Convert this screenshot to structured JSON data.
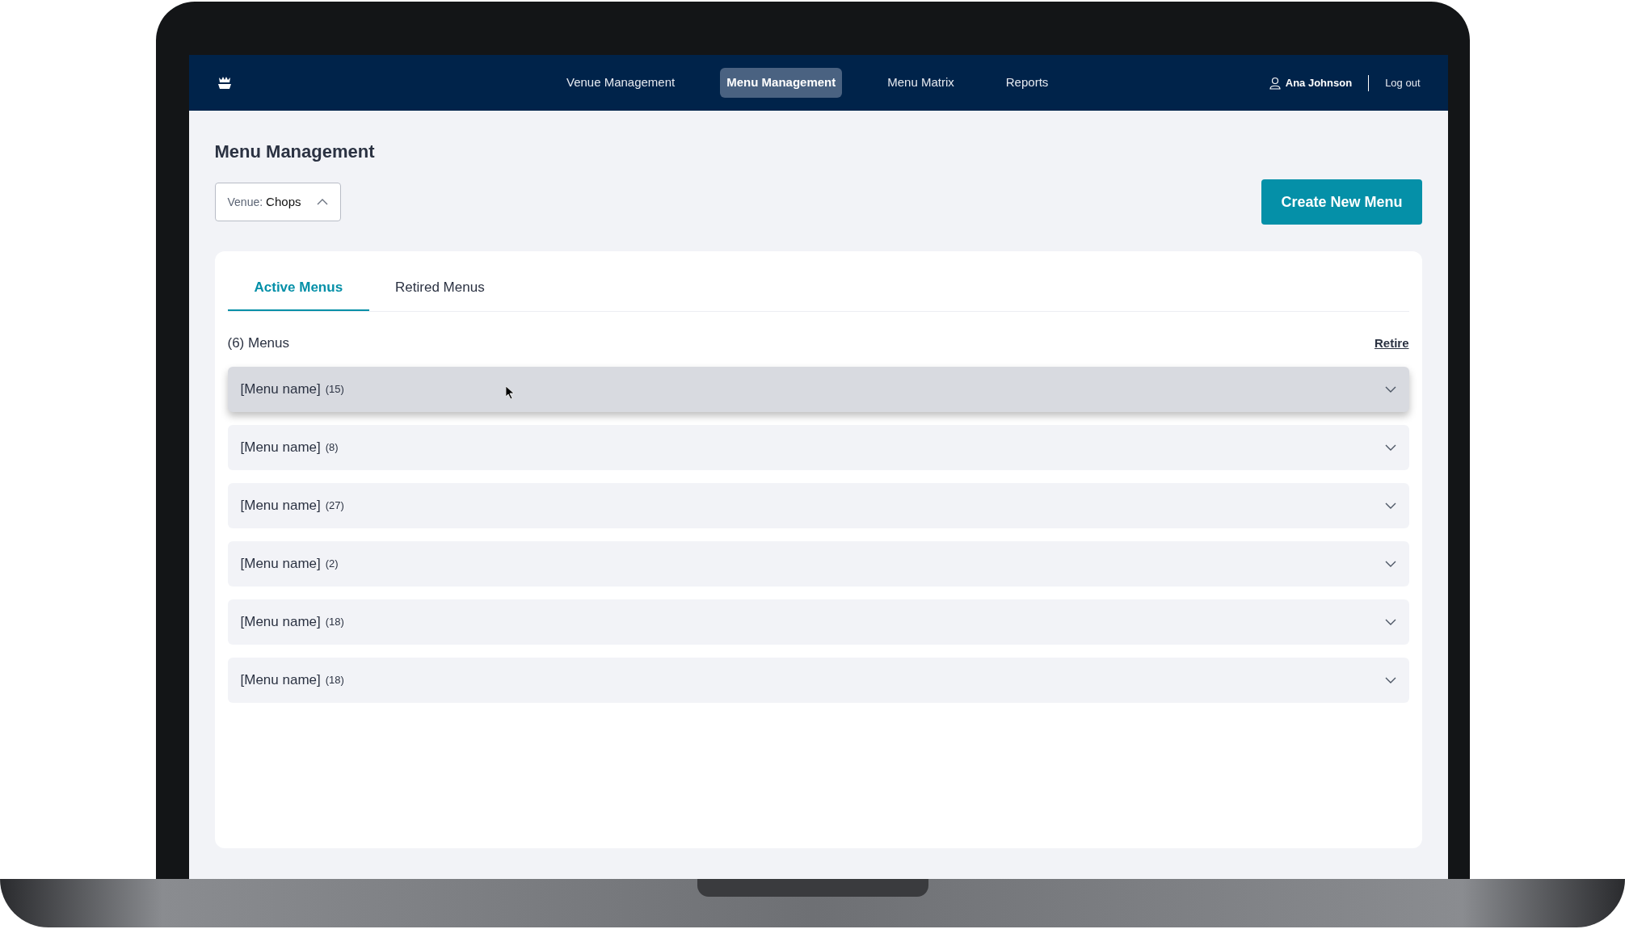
{
  "nav": {
    "items": [
      {
        "label": "Venue Management",
        "selected": false
      },
      {
        "label": "Menu Management",
        "selected": true
      },
      {
        "label": "Menu Matrix",
        "selected": false
      },
      {
        "label": "Reports",
        "selected": false
      }
    ],
    "user": "Ana Johnson",
    "logout": "Log out"
  },
  "page": {
    "title": "Menu Management",
    "venue": {
      "label": "Venue:",
      "value": "Chops"
    },
    "create_button": "Create New Menu"
  },
  "tabs": [
    {
      "label": "Active Menus",
      "selected": true
    },
    {
      "label": "Retired Menus",
      "selected": false
    }
  ],
  "list": {
    "heading": "(6) Menus",
    "action": "Retire",
    "rows": [
      {
        "name": "[Menu name]",
        "count": "(15)",
        "highlighted": true
      },
      {
        "name": "[Menu name]",
        "count": "(8)",
        "highlighted": false
      },
      {
        "name": "[Menu name]",
        "count": "(27)",
        "highlighted": false
      },
      {
        "name": "[Menu name]",
        "count": "(2)",
        "highlighted": false
      },
      {
        "name": "[Menu name]",
        "count": "(18)",
        "highlighted": false
      },
      {
        "name": "[Menu name]",
        "count": "(18)",
        "highlighted": false
      }
    ]
  }
}
